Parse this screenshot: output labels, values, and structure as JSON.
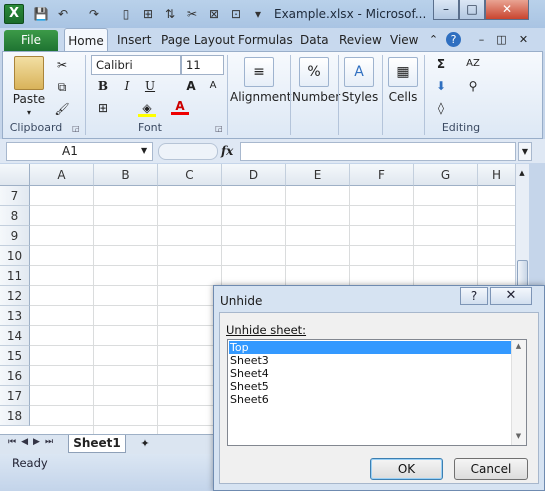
{
  "window": {
    "title": "Example.xlsx - Microsof...",
    "app_icon": "X",
    "controls": {
      "minimize": "–",
      "maximize": "□",
      "close": "✕"
    }
  },
  "ribbon_tabs": [
    "File",
    "Home",
    "Insert",
    "Page Layout",
    "Formulas",
    "Data",
    "Review",
    "View"
  ],
  "ribbon": {
    "clipboard": {
      "paste": "Paste",
      "label": "Clipboard"
    },
    "font": {
      "name": "Calibri",
      "size": "11",
      "bold": "B",
      "italic": "I",
      "underline": "U",
      "label": "Font"
    },
    "alignment": {
      "label": "Alignment"
    },
    "number": {
      "label": "Number",
      "icon_text": "%"
    },
    "styles": {
      "label": "Styles"
    },
    "cells": {
      "label": "Cells"
    },
    "editing": {
      "label": "Editing",
      "sum": "Σ"
    }
  },
  "formula_bar": {
    "name_box": "A1",
    "fx": "fx",
    "value": ""
  },
  "grid": {
    "columns": [
      "A",
      "B",
      "C",
      "D",
      "E",
      "F",
      "G",
      "H"
    ],
    "rows": [
      "7",
      "8",
      "9",
      "10",
      "11",
      "12",
      "13",
      "14",
      "15",
      "16",
      "17",
      "18"
    ]
  },
  "sheet_tabs": {
    "active": "Sheet1"
  },
  "status": {
    "text": "Ready"
  },
  "dialog": {
    "title": "Unhide",
    "help": "?",
    "close": "✕",
    "label": "Unhide sheet:",
    "items": [
      "Top",
      "Sheet3",
      "Sheet4",
      "Sheet5",
      "Sheet6"
    ],
    "selected": "Top",
    "ok": "OK",
    "cancel": "Cancel"
  },
  "colors": {
    "selection": "#3399ff",
    "file_tab": "#2a8a3a"
  }
}
